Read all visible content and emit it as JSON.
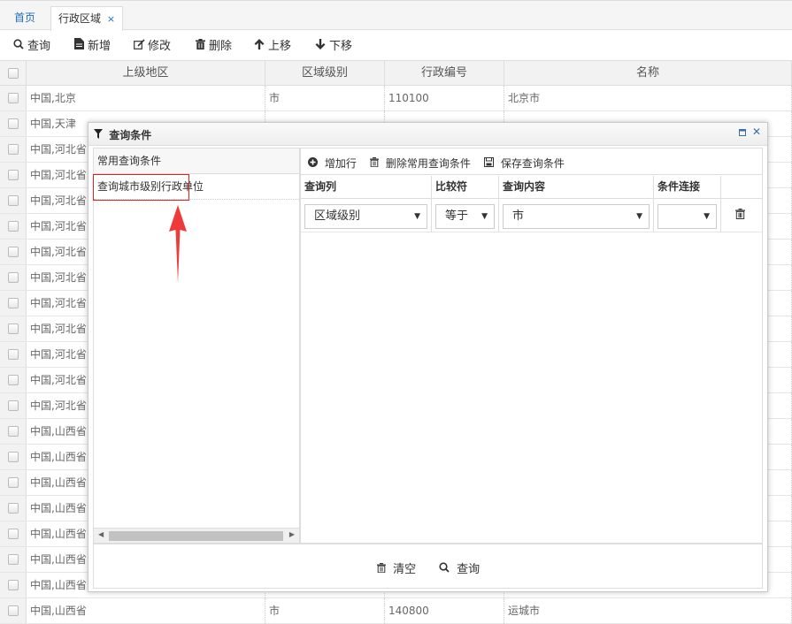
{
  "tabs": {
    "home": "首页",
    "active": "行政区域",
    "close": "×"
  },
  "toolbar": {
    "query": "查询",
    "add": "新增",
    "edit": "修改",
    "delete": "删除",
    "move_up": "上移",
    "move_down": "下移"
  },
  "grid": {
    "headers": [
      "上级地区",
      "区域级别",
      "行政编号",
      "名称"
    ],
    "rows": [
      {
        "parent": "中国,北京",
        "level": "市",
        "code": "110100",
        "name": "北京市"
      },
      {
        "parent": "中国,天津",
        "level": "",
        "code": "",
        "name": ""
      },
      {
        "parent": "中国,河北省",
        "level": "",
        "code": "",
        "name": ""
      },
      {
        "parent": "中国,河北省",
        "level": "",
        "code": "",
        "name": ""
      },
      {
        "parent": "中国,河北省",
        "level": "",
        "code": "",
        "name": ""
      },
      {
        "parent": "中国,河北省",
        "level": "",
        "code": "",
        "name": ""
      },
      {
        "parent": "中国,河北省",
        "level": "",
        "code": "",
        "name": ""
      },
      {
        "parent": "中国,河北省",
        "level": "",
        "code": "",
        "name": ""
      },
      {
        "parent": "中国,河北省",
        "level": "",
        "code": "",
        "name": ""
      },
      {
        "parent": "中国,河北省",
        "level": "",
        "code": "",
        "name": ""
      },
      {
        "parent": "中国,河北省",
        "level": "",
        "code": "",
        "name": ""
      },
      {
        "parent": "中国,河北省",
        "level": "",
        "code": "",
        "name": ""
      },
      {
        "parent": "中国,河北省",
        "level": "",
        "code": "",
        "name": ""
      },
      {
        "parent": "中国,山西省",
        "level": "",
        "code": "",
        "name": ""
      },
      {
        "parent": "中国,山西省",
        "level": "",
        "code": "",
        "name": ""
      },
      {
        "parent": "中国,山西省",
        "level": "",
        "code": "",
        "name": ""
      },
      {
        "parent": "中国,山西省",
        "level": "",
        "code": "",
        "name": ""
      },
      {
        "parent": "中国,山西省",
        "level": "",
        "code": "",
        "name": ""
      },
      {
        "parent": "中国,山西省",
        "level": "",
        "code": "",
        "name": ""
      },
      {
        "parent": "中国,山西省",
        "level": "",
        "code": "",
        "name": ""
      },
      {
        "parent": "中国,山西省",
        "level": "市",
        "code": "140800",
        "name": "运城市"
      }
    ]
  },
  "dialog": {
    "title": "查询条件",
    "common_header": "常用查询条件",
    "common_items": [
      "查询城市级别行政单位"
    ],
    "toolbar": {
      "add_row": "增加行",
      "delete_common": "删除常用查询条件",
      "save": "保存查询条件"
    },
    "columns": [
      "查询列",
      "比较符",
      "查询内容",
      "条件连接"
    ],
    "condition": {
      "column": "区域级别",
      "operator": "等于",
      "value": "市",
      "connector": ""
    },
    "footer": {
      "clear": "清空",
      "query": "查询"
    }
  },
  "colors": {
    "highlight": "#e02020",
    "link": "#1f6fb5",
    "arrow": "#f03a3a"
  }
}
